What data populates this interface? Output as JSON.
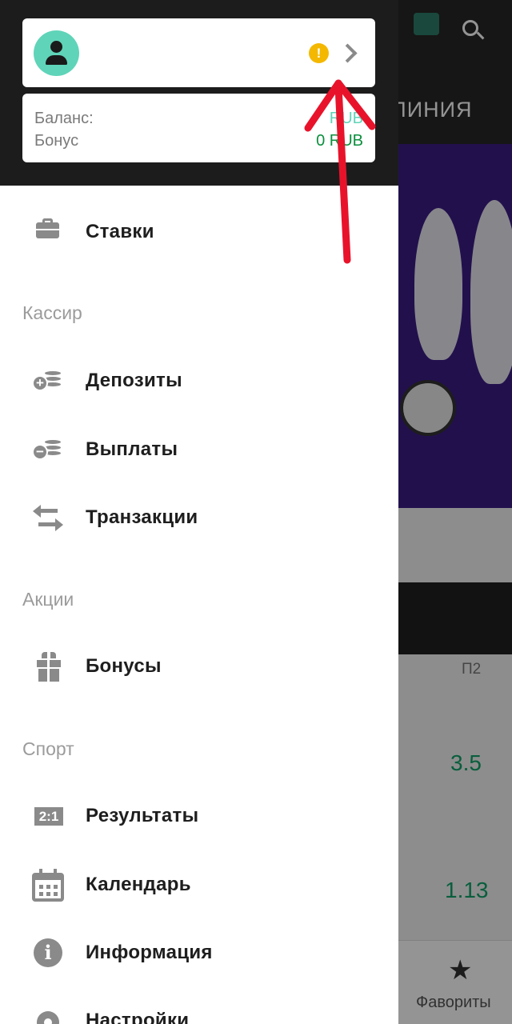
{
  "background": {
    "subbar_label": "ЛИНИЯ",
    "column_header": "П2",
    "odds": [
      "3.5",
      "1.13"
    ],
    "bottom_nav_label": "Фавориты"
  },
  "profile": {
    "warning_symbol": "!"
  },
  "balance": {
    "balance_label": "Баланс:",
    "balance_value": "RUB",
    "bonus_label": "Бонус",
    "bonus_value": "0 RUB",
    "balance_color": "#5fd4b8",
    "bonus_color": "#0a8f3c"
  },
  "menu": {
    "bets": "Ставки",
    "cashier_section": "Кассир",
    "deposits": "Депозиты",
    "payouts": "Выплаты",
    "transactions": "Транзакции",
    "promos_section": "Акции",
    "bonuses": "Бонусы",
    "sport_section": "Спорт",
    "results": "Результаты",
    "results_icon_text": "2:1",
    "calendar": "Календарь",
    "information": "Информация",
    "information_icon_text": "i",
    "settings": "Настройки"
  },
  "colors": {
    "accent": "#5fd4b8",
    "drawer_header": "#1c1c1c",
    "annotation_arrow": "#e8132b"
  }
}
